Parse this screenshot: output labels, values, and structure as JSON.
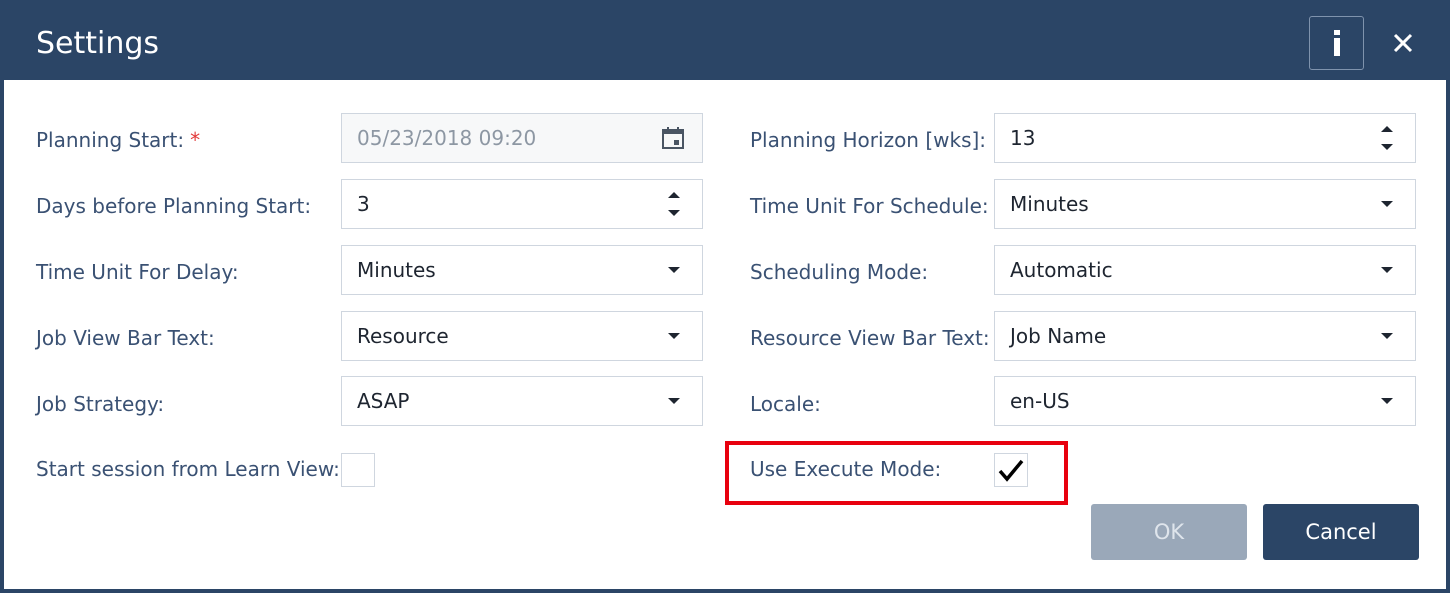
{
  "dialog": {
    "title": "Settings",
    "colors": {
      "header": "#2b4566",
      "label": "#3a5173",
      "required": "#e23a3a",
      "highlight": "#e8000e"
    }
  },
  "icons": {
    "info": "info-icon",
    "close": "close-icon",
    "calendar": "calendar-icon"
  },
  "left": {
    "planning_start": {
      "label": "Planning Start:",
      "required": "*",
      "value": "05/23/2018 09:20"
    },
    "days_before": {
      "label": "Days before Planning Start:",
      "value": "3"
    },
    "time_unit_delay": {
      "label": "Time Unit For Delay:",
      "value": "Minutes"
    },
    "job_view_bar_text": {
      "label": "Job View Bar Text:",
      "value": "Resource"
    },
    "job_strategy": {
      "label": "Job Strategy:",
      "value": "ASAP"
    },
    "start_session": {
      "label": "Start session from Learn View:",
      "checked": false
    }
  },
  "right": {
    "planning_horizon": {
      "label": "Planning Horizon [wks]:",
      "value": "13"
    },
    "time_unit_schedule": {
      "label": "Time Unit For Schedule:",
      "value": "Minutes"
    },
    "scheduling_mode": {
      "label": "Scheduling Mode:",
      "value": "Automatic"
    },
    "resource_view_bar_text": {
      "label": "Resource View Bar Text:",
      "value": "Job Name"
    },
    "locale": {
      "label": "Locale:",
      "value": "en-US"
    },
    "use_execute_mode": {
      "label": "Use Execute Mode:",
      "checked": true
    }
  },
  "buttons": {
    "ok": "OK",
    "cancel": "Cancel"
  }
}
